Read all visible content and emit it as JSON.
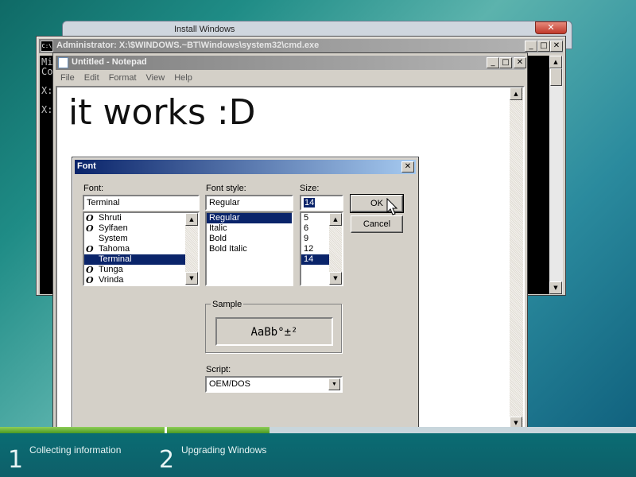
{
  "setup_window": {
    "title": "Install Windows",
    "close_symbol": "✕"
  },
  "cmd_window": {
    "title": "Administrator: X:\\$WINDOWS.~BT\\Windows\\system32\\cmd.exe",
    "icon_text": "C:\\",
    "console_lines": [
      "Mi",
      "Co",
      "",
      "X:",
      "",
      "X:"
    ],
    "buttons": {
      "minimize": "_",
      "maximize": "□",
      "close": "✕"
    }
  },
  "notepad_window": {
    "title": "Untitled - Notepad",
    "menu": [
      "File",
      "Edit",
      "Format",
      "View",
      "Help"
    ],
    "content": "it works :D",
    "buttons": {
      "minimize": "_",
      "maximize": "□",
      "close": "✕"
    }
  },
  "font_dialog": {
    "title": "Font",
    "close_symbol": "✕",
    "font": {
      "label": "Font:",
      "value": "Terminal",
      "items": [
        {
          "name": "Shruti",
          "opentype": true,
          "selected": false
        },
        {
          "name": "Sylfaen",
          "opentype": true,
          "selected": false
        },
        {
          "name": "System",
          "opentype": false,
          "selected": false
        },
        {
          "name": "Tahoma",
          "opentype": true,
          "selected": false
        },
        {
          "name": "Terminal",
          "opentype": false,
          "selected": true
        },
        {
          "name": "Tunga",
          "opentype": true,
          "selected": false
        },
        {
          "name": "Vrinda",
          "opentype": true,
          "selected": false
        }
      ]
    },
    "style": {
      "label": "Font style:",
      "value": "Regular",
      "items": [
        {
          "name": "Regular",
          "selected": true
        },
        {
          "name": "Italic",
          "selected": false
        },
        {
          "name": "Bold",
          "selected": false
        },
        {
          "name": "Bold Italic",
          "selected": false
        }
      ]
    },
    "size": {
      "label": "Size:",
      "value": "14",
      "items": [
        {
          "name": "5",
          "selected": false
        },
        {
          "name": "6",
          "selected": false
        },
        {
          "name": "9",
          "selected": false
        },
        {
          "name": "12",
          "selected": false
        },
        {
          "name": "14",
          "selected": true
        }
      ]
    },
    "ok_label": "OK",
    "cancel_label": "Cancel",
    "sample": {
      "label": "Sample",
      "text": "AaBb°±²"
    },
    "script": {
      "label": "Script:",
      "value": "OEM/DOS"
    }
  },
  "setup_progress": {
    "steps": [
      {
        "number": "1",
        "label": "Collecting information",
        "progress": 1.0
      },
      {
        "number": "2",
        "label": "Upgrading Windows",
        "progress": 0.33
      }
    ],
    "colors": {
      "fill": "#6fb83a",
      "band": "#0a6c73"
    }
  }
}
